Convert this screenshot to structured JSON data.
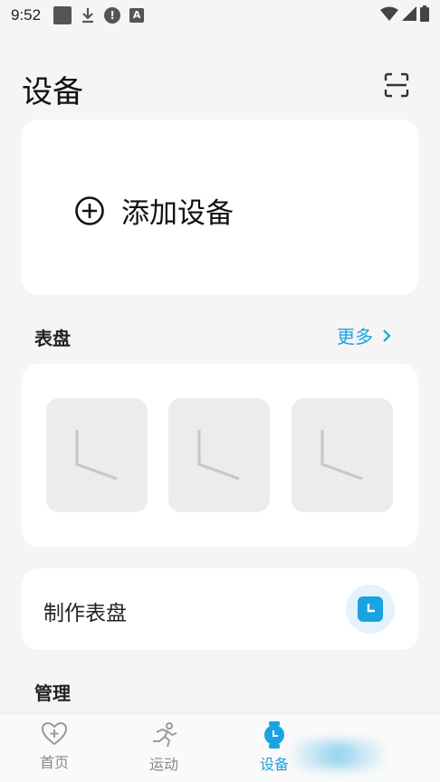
{
  "status_bar": {
    "time": "9:52",
    "icons": [
      "square-notification-icon",
      "download-icon",
      "alert-icon",
      "a-icon",
      "wifi-icon",
      "signal-icon",
      "battery-icon"
    ]
  },
  "header": {
    "title": "设备",
    "scan_icon": "scan-icon"
  },
  "add_device": {
    "label": "添加设备",
    "icon": "plus-circle-icon"
  },
  "watch_faces": {
    "title": "表盘",
    "more_label": "更多",
    "faces": [
      {
        "icon": "clock-face-icon"
      },
      {
        "icon": "clock-face-icon"
      },
      {
        "icon": "clock-face-icon"
      }
    ]
  },
  "make_face": {
    "label": "制作表盘",
    "icon": "clock-icon"
  },
  "manage": {
    "title": "管理"
  },
  "bottom_nav": {
    "items": [
      {
        "label": "首页",
        "icon": "heart-plus-icon",
        "active": false
      },
      {
        "label": "运动",
        "icon": "running-icon",
        "active": false
      },
      {
        "label": "设备",
        "icon": "watch-icon",
        "active": true
      }
    ]
  },
  "colors": {
    "accent": "#1aa3e0",
    "background": "#f5f5f5",
    "card": "#ffffff"
  }
}
